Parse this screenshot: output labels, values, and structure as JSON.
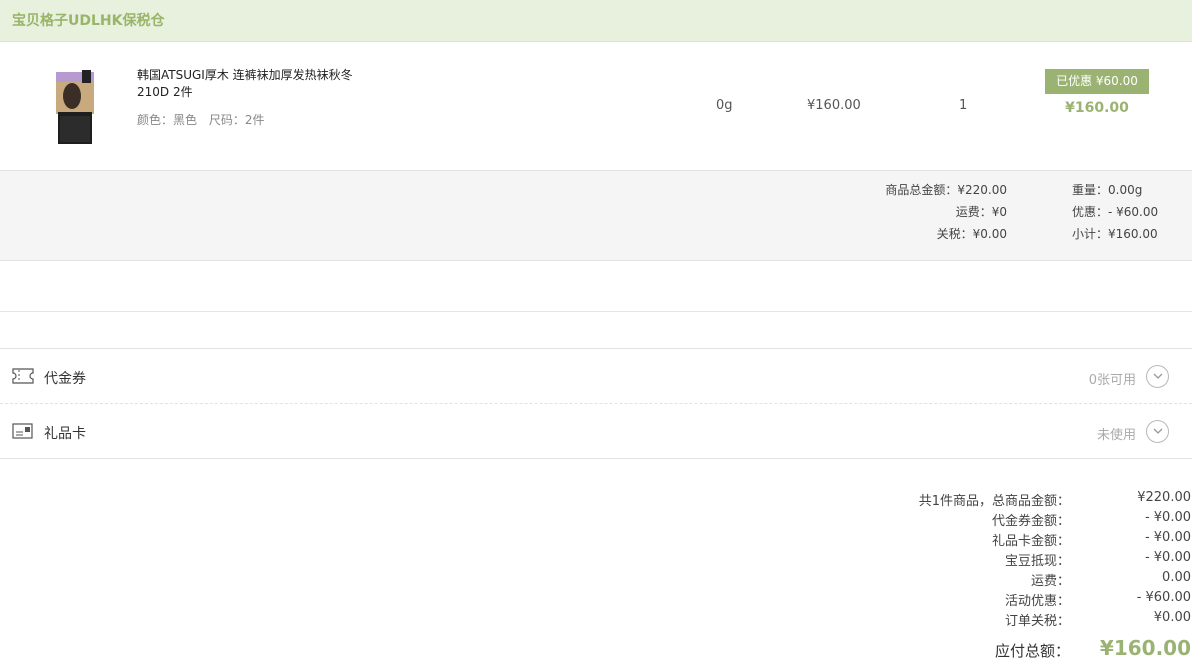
{
  "store": {
    "name": "宝贝格子UDLHK保税仓"
  },
  "item": {
    "title": "韩国ATSUGI厚木 连裤袜加厚发热袜秋冬210D 2件",
    "color": "颜色：黑色",
    "size": "尺码：2件",
    "weight": "0g",
    "price": "¥160.00",
    "quantity": "1",
    "discount_badge": "已优惠 ¥60.00",
    "total": "¥160.00"
  },
  "summary": {
    "goods_total": "商品总金额：¥220.00",
    "shipping": "运费：¥0",
    "tax": "关税：¥0.00",
    "weight": "重量：0.00g",
    "discount": "优惠：- ¥60.00",
    "subtotal": "小计：¥160.00"
  },
  "coupon": {
    "label": "代金券",
    "status": "0张可用",
    "icon": "voucher-icon"
  },
  "giftcard": {
    "label": "礼品卡",
    "status": "未使用",
    "icon": "giftcard-icon"
  },
  "totals": {
    "lines": [
      {
        "label": "共1件商品，总商品金额：",
        "value": "¥220.00"
      },
      {
        "label": "代金券金额：",
        "value": "- ¥0.00"
      },
      {
        "label": "礼品卡金额：",
        "value": "- ¥0.00"
      },
      {
        "label": "宝豆抵现：",
        "value": "- ¥0.00"
      },
      {
        "label": "运费：",
        "value": "0.00"
      },
      {
        "label": "活动优惠：",
        "value": "- ¥60.00"
      },
      {
        "label": "订单关税：",
        "value": "¥0.00"
      }
    ],
    "grand_label": "应付总额：",
    "grand_value": "¥160.00"
  },
  "colors": {
    "accent": "#9bb372",
    "header_bg": "#e8f0de"
  }
}
